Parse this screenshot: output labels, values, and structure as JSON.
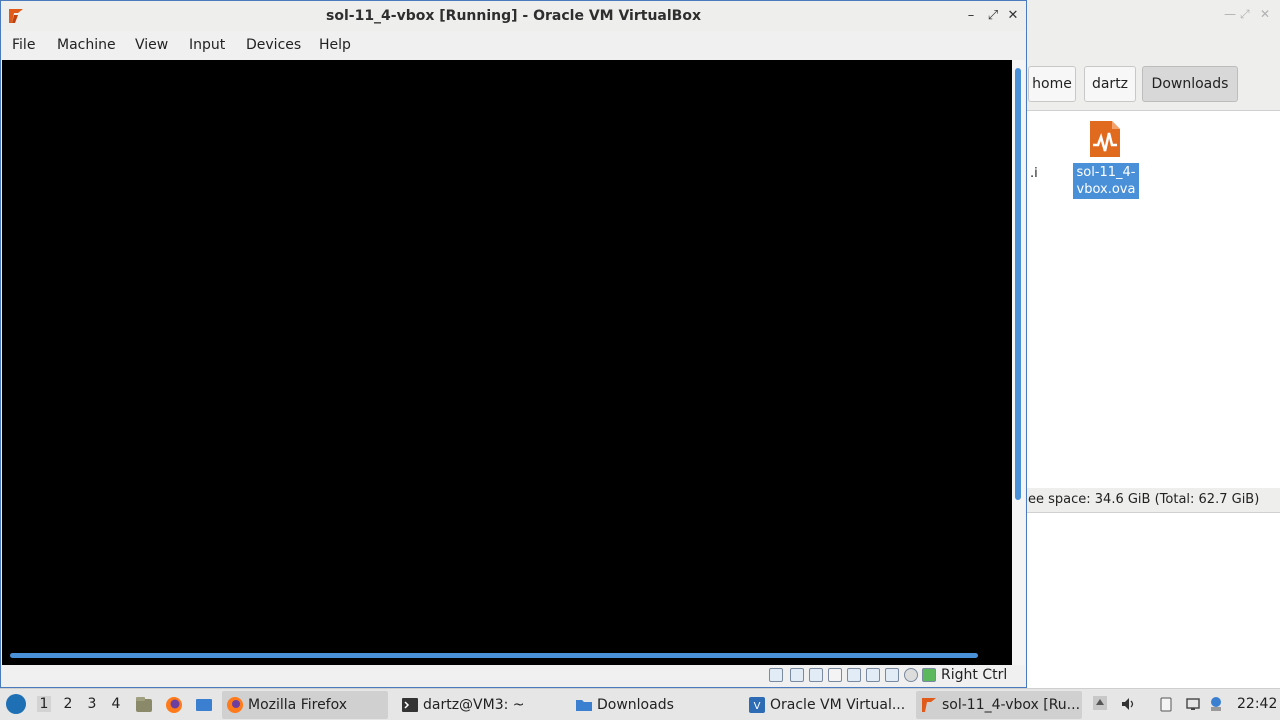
{
  "file_manager": {
    "path_buttons": [
      "home",
      "dartz",
      "Downloads"
    ],
    "cut_item_label": ".i",
    "selected_file": "sol-11_4-vbox.ova",
    "selected_file_line1": "sol-11_4-",
    "selected_file_line2": "vbox.ova",
    "status": "ee space: 34.6 GiB (Total: 62.7 GiB)"
  },
  "virtualbox": {
    "title": "sol-11_4-vbox [Running] - Oracle VM VirtualBox",
    "menu": [
      "File",
      "Machine",
      "View",
      "Input",
      "Devices",
      "Help"
    ],
    "host_key": "Right Ctrl",
    "window_controls": {
      "minimize": "–",
      "maximize": "⤢",
      "close": "✕"
    },
    "status_icons": [
      "hard-disk-icon",
      "optical-drive-icon",
      "audio-icon",
      "network-icon",
      "usb-icon",
      "shared-folders-icon",
      "display-icon",
      "video-capture-icon",
      "mouse-integration-icon",
      "keyboard-icon"
    ]
  },
  "taskbar": {
    "workspaces": [
      "1",
      "2",
      "3",
      "4"
    ],
    "tasks": [
      {
        "label": "Mozilla Firefox",
        "icon": "firefox-icon"
      },
      {
        "label": "dartz@VM3: ~",
        "icon": "terminal-icon"
      },
      {
        "label": "Downloads",
        "icon": "folder-icon"
      },
      {
        "label": "Oracle VM Virtual...",
        "icon": "virtualbox-icon"
      },
      {
        "label": "sol-11_4-vbox [Ru...",
        "icon": "virtualbox-vm-icon"
      }
    ],
    "clock": "22:42"
  },
  "colors": {
    "selection": "#4a90d9",
    "vbox_orange": "#e06b1f",
    "window_border": "#4a7bbf"
  }
}
